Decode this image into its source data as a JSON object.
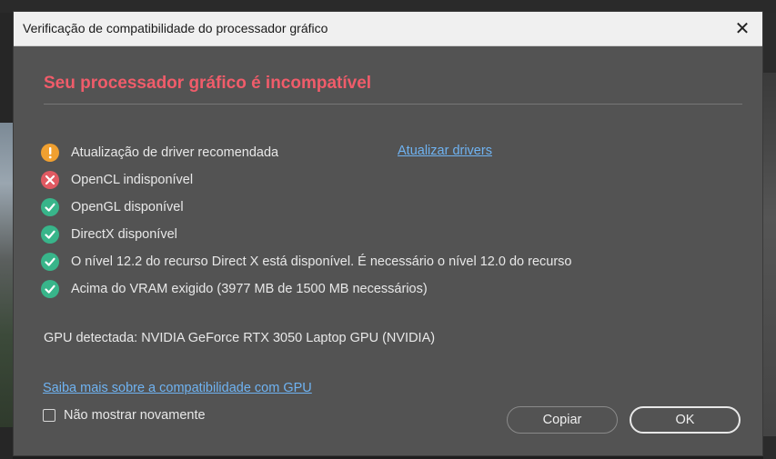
{
  "dialog": {
    "title": "Verificação de compatibilidade do processador gráfico",
    "close_symbol": "✕",
    "heading": "Seu processador gráfico é incompatível",
    "heading_color": "#f05c6a",
    "items": [
      {
        "status": "warning",
        "icon": "warning-icon",
        "label": "Atualização de driver recomendada"
      },
      {
        "status": "error",
        "icon": "error-icon",
        "label": "OpenCL indisponível"
      },
      {
        "status": "ok",
        "icon": "check-icon",
        "label": "OpenGL disponível"
      },
      {
        "status": "ok",
        "icon": "check-icon",
        "label": "DirectX disponível"
      },
      {
        "status": "ok",
        "icon": "check-icon",
        "label": "O nível 12.2 do recurso Direct X está disponível. É necessário o nível 12.0 do recurso"
      },
      {
        "status": "ok",
        "icon": "check-icon",
        "label": "Acima do VRAM exigido (3977 MB de 1500 MB necessários)"
      }
    ],
    "update_drivers_link": "Atualizar drivers",
    "gpu_detected": "GPU detectada: NVIDIA GeForce RTX 3050 Laptop GPU (NVIDIA)",
    "learn_more_link": "Saiba mais sobre a compatibilidade com GPU",
    "dont_show_again": {
      "label": "Não mostrar novamente",
      "checked": false
    },
    "buttons": {
      "copy": "Copiar",
      "ok": "OK"
    },
    "colors": {
      "warning": "#f0a030",
      "error": "#e05a62",
      "ok": "#38b58a",
      "link": "#6fb3f2"
    }
  }
}
